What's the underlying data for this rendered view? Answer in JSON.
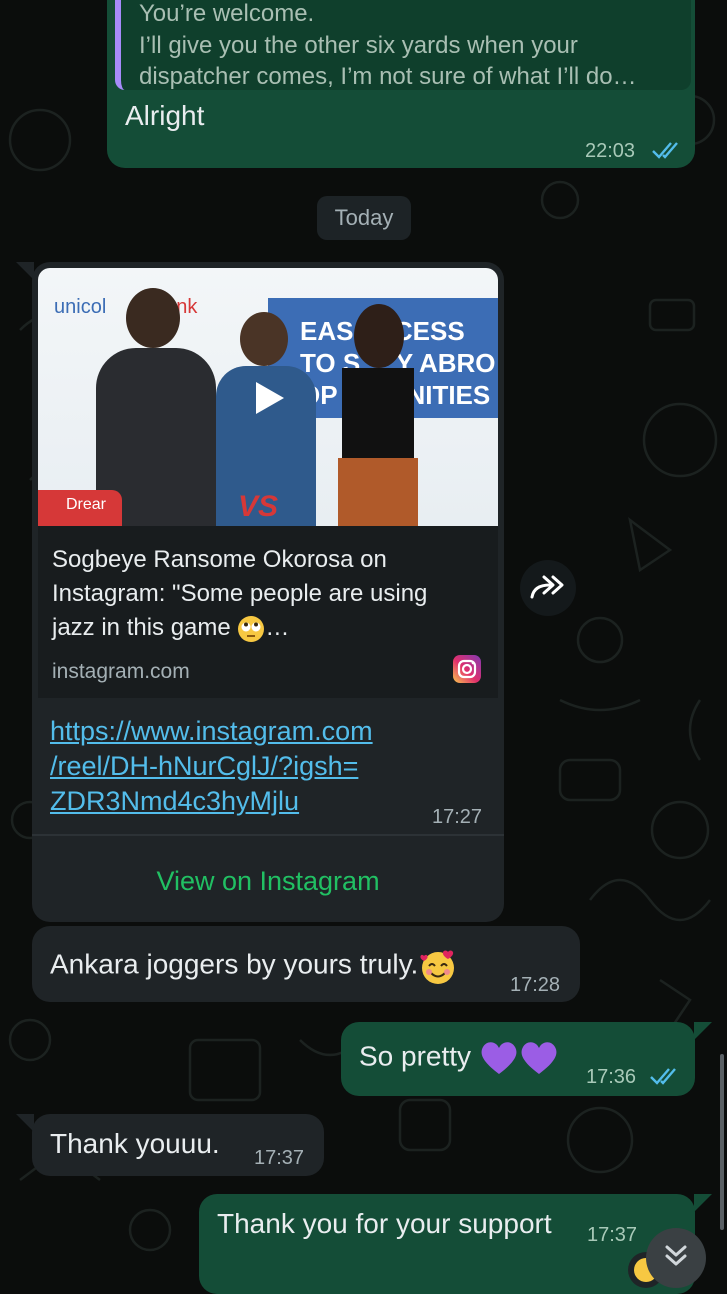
{
  "colors": {
    "outgoing_bubble": "#144d37",
    "incoming_bubble": "#1f2427",
    "link": "#53bdeb",
    "accent_green": "#21c063",
    "read_ticks": "#53bdeb"
  },
  "messages": {
    "top": {
      "quote_line1": "You’re welcome.",
      "quote_line2": "I’ll give you the other six yards when your",
      "quote_line3": "dispatcher comes, I’m not sure of what I’ll do…",
      "text": "Alright",
      "time": "22:03",
      "status_icon": "double-check-read-icon"
    },
    "date_divider": "Today",
    "link_preview": {
      "video_overlay_text_line1": "EAS   CCESS",
      "video_overlay_text_line2": "TO S     Y ABRO",
      "video_overlay_text_line3": "OP       UNITIES",
      "video_brand": "unicol",
      "video_brand_tail": "nk",
      "video_badge": "VS",
      "video_corner": "Drear",
      "title_line1": "Sogbeye Ransome Okorosa on",
      "title_line2": "Instagram: \"Some people are using",
      "title_line3": "jazz in this game",
      "title_ellipsis": "…",
      "domain": "instagram.com",
      "url_line1": "https://www.instagram.com",
      "url_line2": "/reel/DH-hNurCglJ/?igsh=",
      "url_line3": "ZDR3Nmd4c3hyMjlu",
      "time": "17:27",
      "action_label": "View on Instagram"
    },
    "ankara": {
      "text": "Ankara joggers by yours truly.",
      "time": "17:28"
    },
    "pretty": {
      "text": "So pretty",
      "time": "17:36",
      "status_icon": "double-check-read-icon"
    },
    "thanks": {
      "text": "Thank youuu.",
      "time": "17:37"
    },
    "support": {
      "text": "Thank you for your support",
      "time": "17:37"
    }
  },
  "icons": {
    "forward": "forward-share-icon",
    "play": "play-icon",
    "instagram": "instagram-logo-icon",
    "scroll_down": "chevron-double-down-icon"
  }
}
